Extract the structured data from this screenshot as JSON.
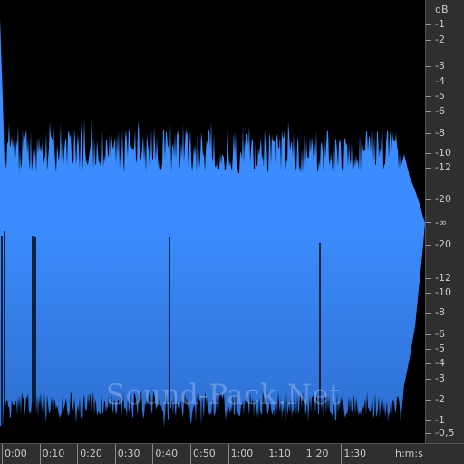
{
  "colors": {
    "background": "#000000",
    "waveform_light": "#3b8cff",
    "waveform_dark": "#2e6fd0",
    "ruler_bg": "#2f2f2f",
    "ruler_text": "#c9c9c9"
  },
  "db_ruler": {
    "unit_label": "dB",
    "top_labels": [
      "-1",
      "-2",
      "-3",
      "-4",
      "-5",
      "-6",
      "-8",
      "-10",
      "-12",
      "-20"
    ],
    "center_label": "-∞",
    "bottom_labels": [
      "-20",
      "-12",
      "-10",
      "-8",
      "-6",
      "-5",
      "-4",
      "-3",
      "-2",
      "-1",
      "-0,5"
    ]
  },
  "time_ruler": {
    "unit_label": "h:m:s",
    "labels": [
      "0:00",
      "0:10",
      "0:20",
      "0:30",
      "0:40",
      "0:50",
      "1:00",
      "1:10",
      "1:20",
      "1:30"
    ]
  },
  "watermark": "Sound-Pack.Net"
}
